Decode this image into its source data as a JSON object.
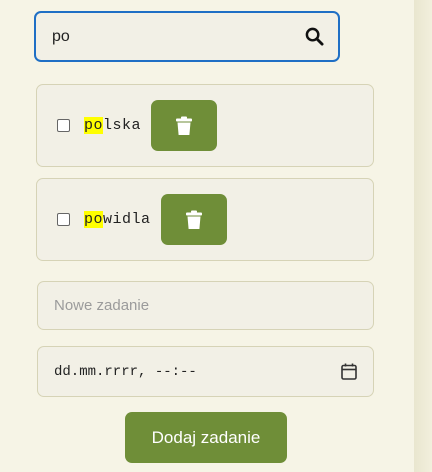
{
  "search": {
    "value": "po",
    "icon": "search-icon"
  },
  "tasks": [
    {
      "highlight": "po",
      "rest": "lska",
      "checked": false,
      "delete_icon": "trash-icon"
    },
    {
      "highlight": "po",
      "rest": "widla",
      "checked": false,
      "delete_icon": "trash-icon"
    }
  ],
  "new_task": {
    "placeholder": "Nowe zadanie",
    "date_value": "dd.mm.rrrr, --:--",
    "calendar_icon": "calendar-icon"
  },
  "add_button": {
    "label": "Dodaj zadanie"
  },
  "colors": {
    "accent": "#6f8e38",
    "focus_border": "#1f6fc5",
    "highlight": "#ffff00",
    "background": "#f6f4e6"
  }
}
